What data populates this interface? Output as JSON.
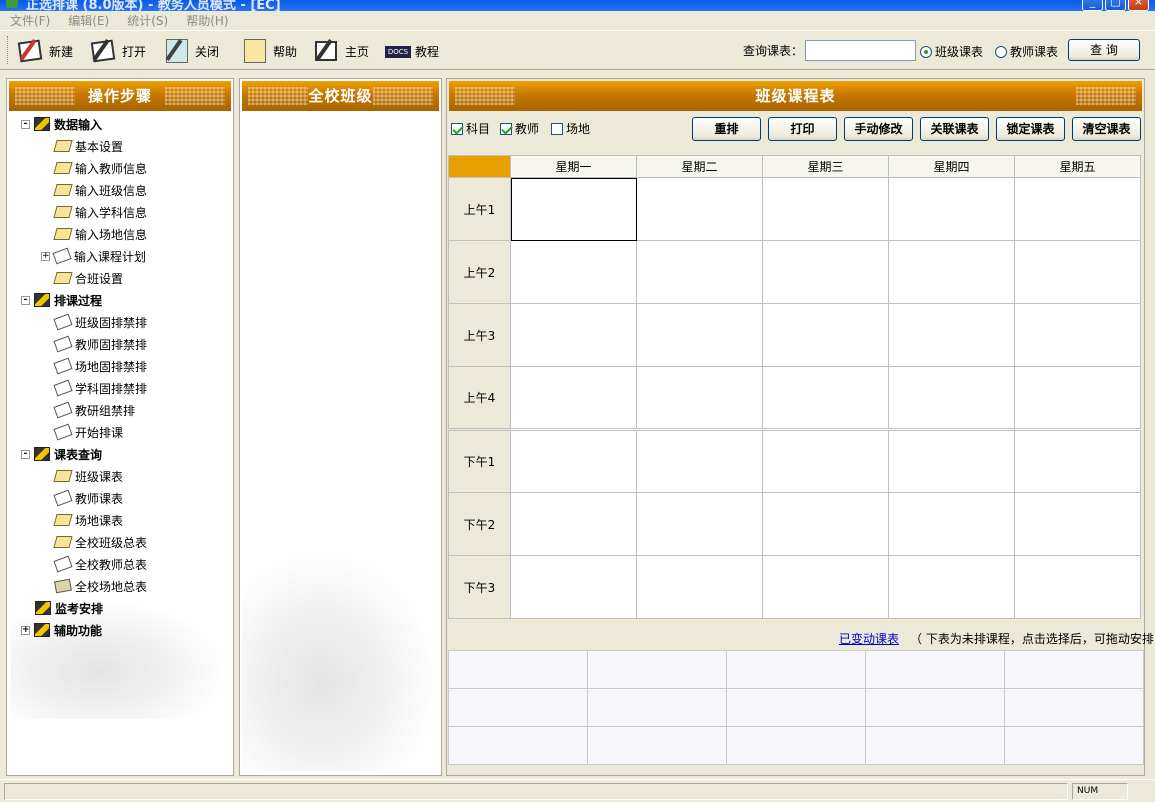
{
  "window": {
    "title": "正选排课 (8.0版本) - 教务人员模式 - [EC]",
    "controls": [
      "_",
      "□",
      "×"
    ]
  },
  "menu": [
    "文件(F)",
    "编辑(E)",
    "统计(S)",
    "帮助(H)"
  ],
  "toolbar": {
    "buttons": [
      {
        "label": "新建",
        "icon": "new-pen-icon"
      },
      {
        "label": "打开",
        "icon": "open-icon"
      },
      {
        "label": "关闭",
        "icon": "close-calc-icon"
      },
      {
        "label": "帮助",
        "icon": "help-book-icon"
      },
      {
        "label": "主页",
        "icon": "home-icon"
      },
      {
        "label": "教程",
        "icon": "docs-icon"
      }
    ],
    "docs_badge": "DOCS",
    "search_label": "查询课表：",
    "search_value": "",
    "radio_class": "班级课表",
    "radio_teacher": "教师课表",
    "radio_selected": "班级课表",
    "query_button": "查 询"
  },
  "left_panel": {
    "title": "操作步骤",
    "tree": [
      {
        "label": "数据输入",
        "root": true,
        "expander": "-",
        "children": [
          "基本设置",
          "输入教师信息",
          "输入班级信息",
          "输入学科信息",
          "输入场地信息",
          "输入课程计划",
          "合班设置"
        ]
      },
      {
        "label": "排课过程",
        "root": true,
        "expander": "-",
        "children": [
          "班级固排禁排",
          "教师固排禁排",
          "场地固排禁排",
          "学科固排禁排",
          "教研组禁排",
          "开始排课"
        ]
      },
      {
        "label": "课表查询",
        "root": true,
        "expander": "-",
        "children": [
          "班级课表",
          "教师课表",
          "场地课表",
          "全校班级总表",
          "全校教师总表",
          "全校场地总表"
        ]
      },
      {
        "label": "监考安排",
        "root": true,
        "expander": "",
        "children": []
      },
      {
        "label": "辅助功能",
        "root": true,
        "expander": "+",
        "children": []
      }
    ]
  },
  "middle_panel": {
    "title": "全校班级"
  },
  "right_panel": {
    "title": "班级课程表",
    "checkboxes": [
      {
        "label": "科目",
        "checked": true
      },
      {
        "label": "教师",
        "checked": true
      },
      {
        "label": "场地",
        "checked": false
      }
    ],
    "actions": [
      "重排",
      "打印",
      "手动修改",
      "关联课表",
      "锁定课表",
      "清空课表"
    ],
    "days": [
      "星期一",
      "星期二",
      "星期三",
      "星期四",
      "星期五"
    ],
    "periods": [
      "上午1",
      "上午2",
      "上午3",
      "上午4",
      "下午1",
      "下午2",
      "下午3"
    ],
    "changed_link": "已变动课表",
    "hint": "（ 下表为未排课程，点击选择后，可拖动安排 ）"
  },
  "status": {
    "num": "NUM"
  },
  "colors": {
    "header_orange": "#c67800",
    "corner": "#e8a000",
    "link": "#0000cc"
  }
}
